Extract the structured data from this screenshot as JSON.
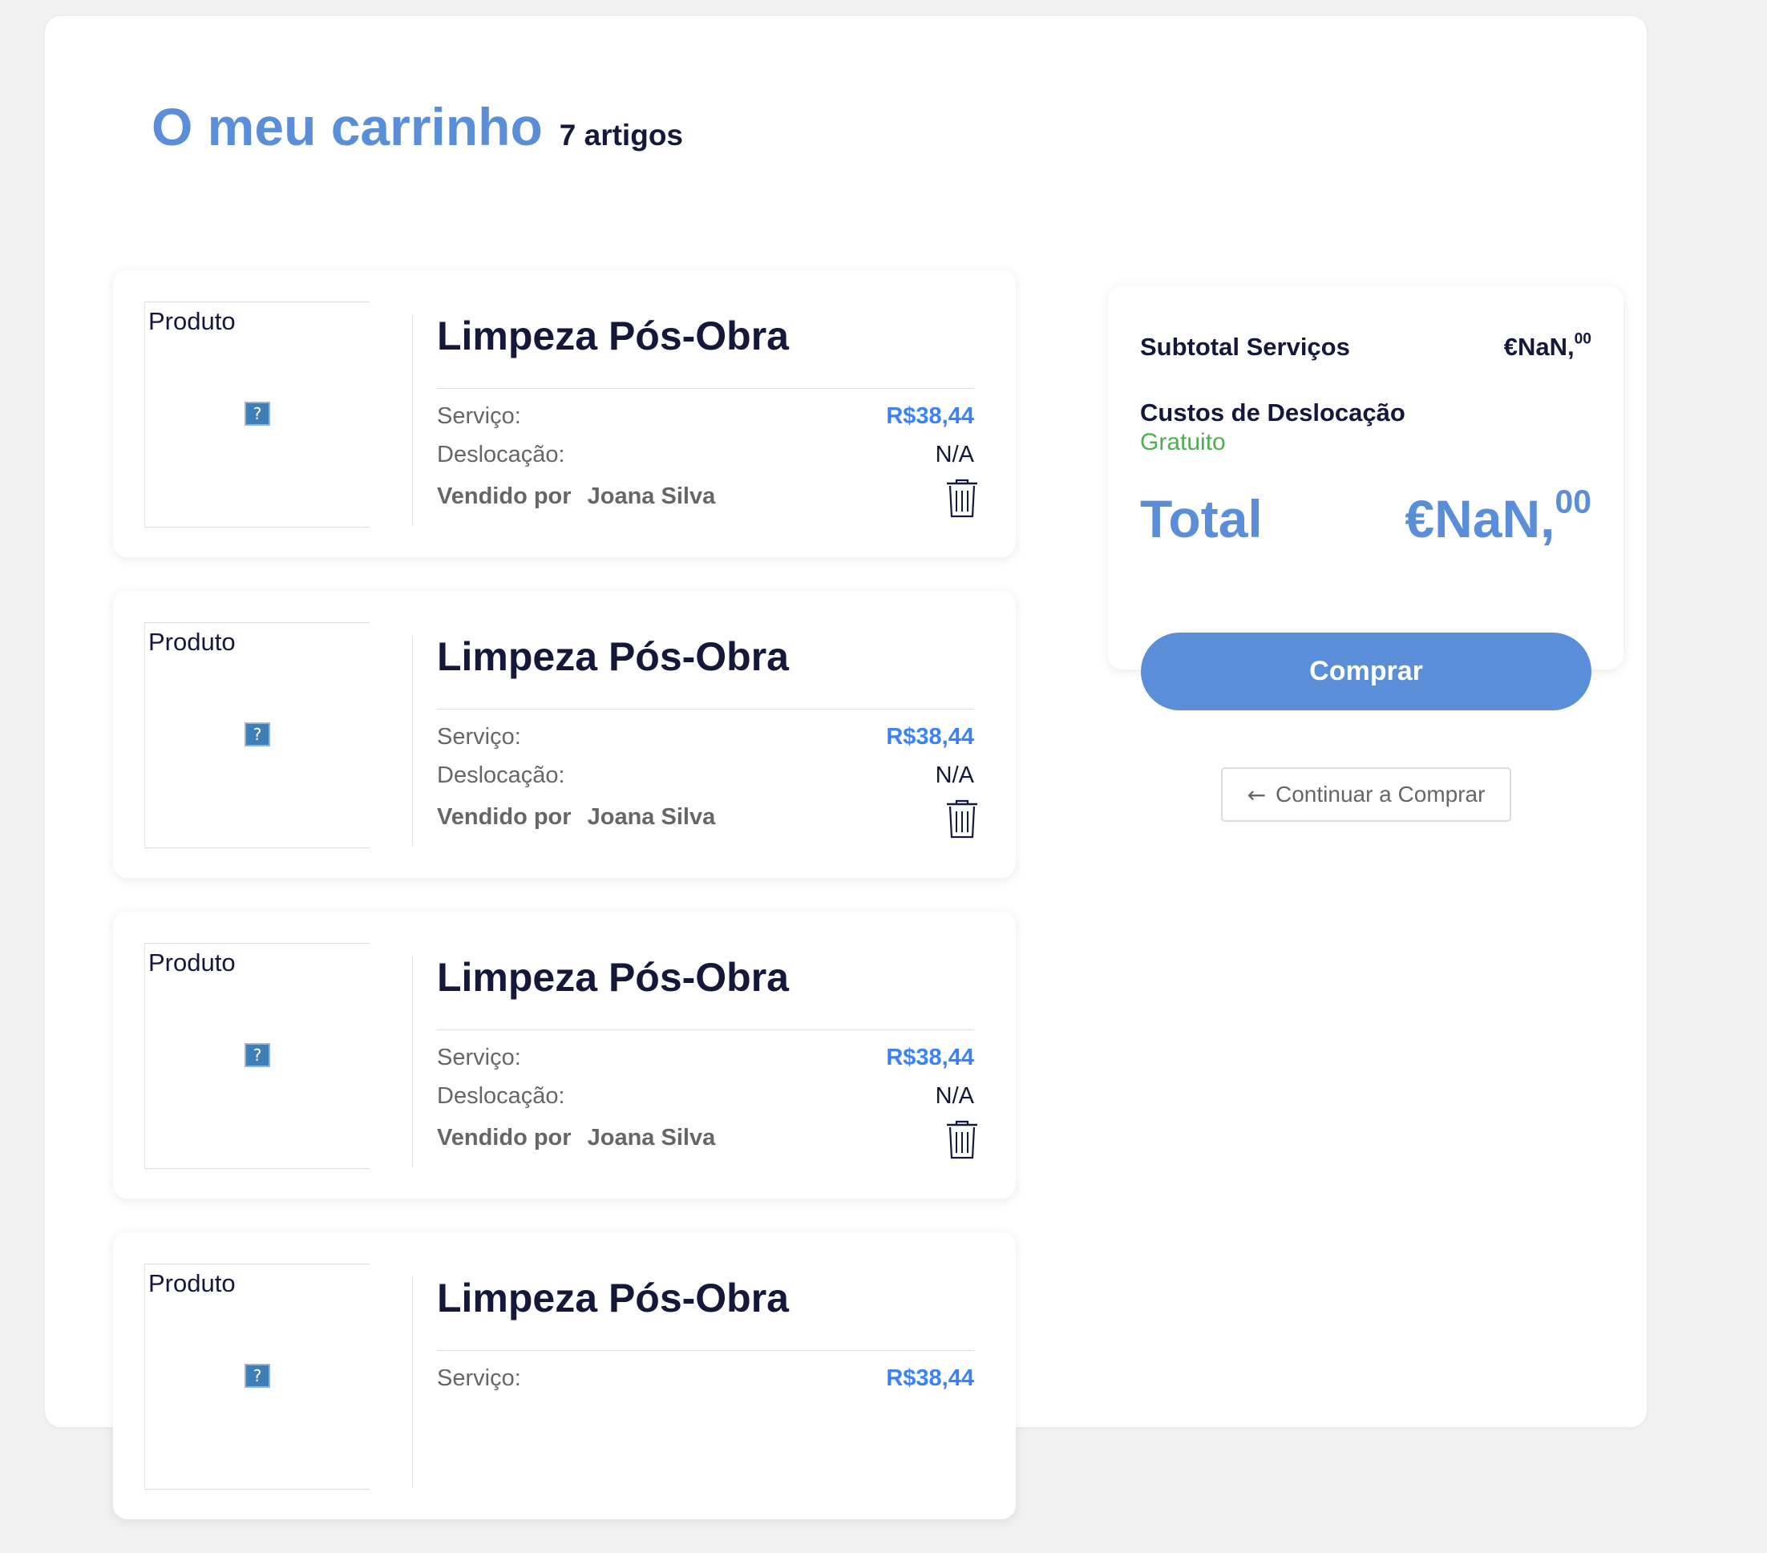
{
  "cart": {
    "title": "O meu carrinho",
    "count_label": "7 artigos"
  },
  "items": [
    {
      "image_alt": "Produto",
      "name": "Limpeza Pós-Obra",
      "service_label": "Serviço:",
      "service_price": "R$38,44",
      "travel_label": "Deslocação:",
      "travel_value": "N/A",
      "sold_by_label": "Vendido por",
      "seller": "Joana Silva"
    },
    {
      "image_alt": "Produto",
      "name": "Limpeza Pós-Obra",
      "service_label": "Serviço:",
      "service_price": "R$38,44",
      "travel_label": "Deslocação:",
      "travel_value": "N/A",
      "sold_by_label": "Vendido por",
      "seller": "Joana Silva"
    },
    {
      "image_alt": "Produto",
      "name": "Limpeza Pós-Obra",
      "service_label": "Serviço:",
      "service_price": "R$38,44",
      "travel_label": "Deslocação:",
      "travel_value": "N/A",
      "sold_by_label": "Vendido por",
      "seller": "Joana Silva"
    },
    {
      "image_alt": "Produto",
      "name": "Limpeza Pós-Obra",
      "service_label": "Serviço:",
      "service_price": "R$38,44"
    }
  ],
  "summary": {
    "subtotal_label": "Subtotal Serviços",
    "subtotal_value": "€NaN,",
    "subtotal_cents": "00",
    "travel_costs_label": "Custos de Deslocação",
    "travel_costs_value": "Gratuito",
    "total_label": "Total",
    "total_value": "€NaN,",
    "total_cents": "00"
  },
  "actions": {
    "buy_label": "Comprar",
    "continue_arrow": "←",
    "continue_label": "Continuar a Comprar"
  },
  "icons": {
    "trash": "trash-icon",
    "broken_image": "broken-image-icon",
    "arrow": "arrow-left-icon"
  },
  "colors": {
    "accent": "#5b8ed9",
    "price": "#3b82f6",
    "free": "#4caf50",
    "text_dark": "#15183a"
  }
}
